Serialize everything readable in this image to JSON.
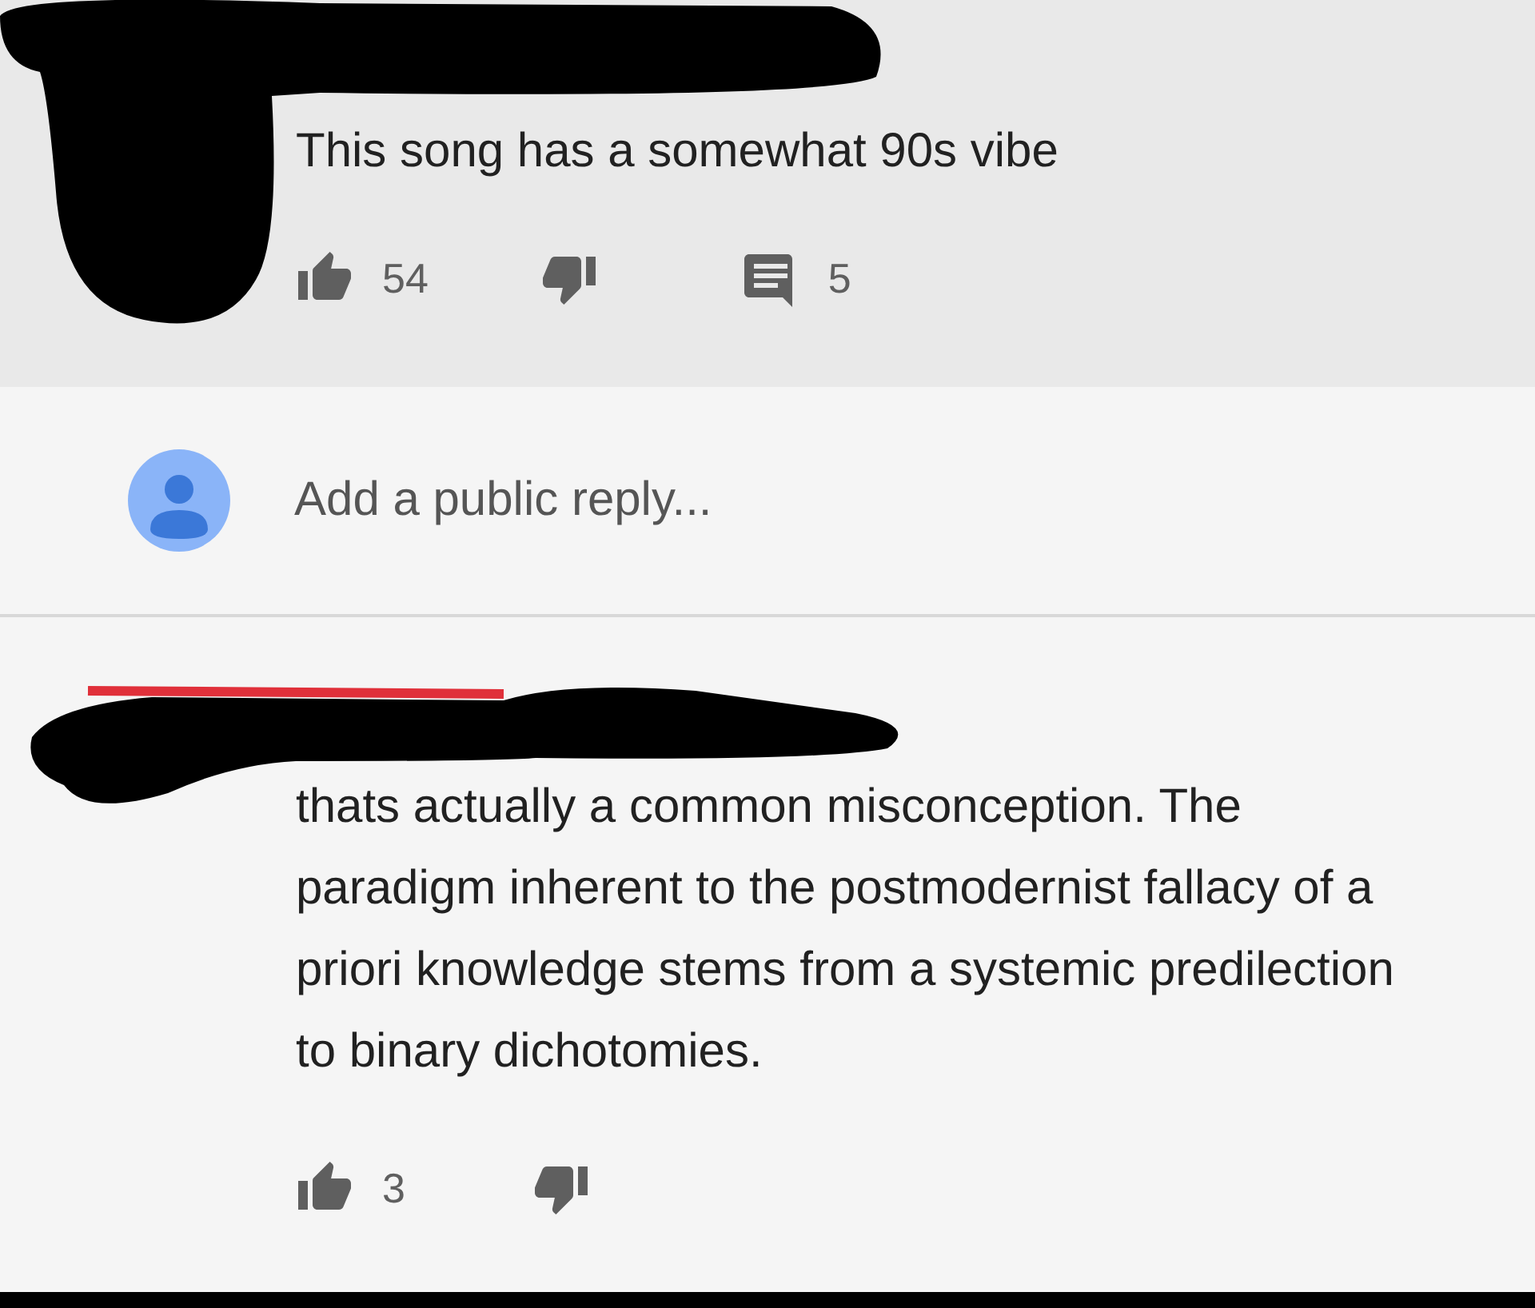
{
  "comments": [
    {
      "text": "This song has a somewhat 90s vibe",
      "likes": "54",
      "replies": "5"
    },
    {
      "text": "thats actually a common misconception. The paradigm inherent to the postmodernist fallacy of a priori knowledge stems from a systemic predilection to binary dichotomies.",
      "likes": "3"
    }
  ],
  "reply_box": {
    "placeholder": "Add a public reply..."
  }
}
